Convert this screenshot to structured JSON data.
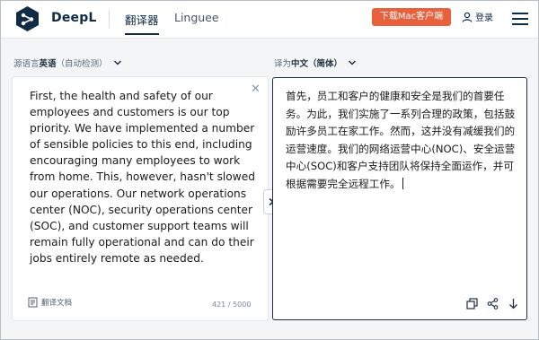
{
  "header": {
    "brand": "DeepL",
    "tabs": [
      {
        "label": "翻译器",
        "active": true
      },
      {
        "label": "Linguee",
        "active": false
      }
    ],
    "download_button": "下载Mac客户端",
    "login_label": "登录"
  },
  "source": {
    "lang_prefix": "源语言",
    "lang_name": "英语",
    "lang_suffix": "（自动检测）",
    "text": "First, the health and safety of our employees and customers is our top priority. We have implemented a number of sensible policies to this end, including encouraging many employees to work from home. This, however, hasn't slowed our operations. Our network operations center (NOC), security operations center (SOC), and customer support teams will remain fully operational and can do their jobs entirely remote as needed.",
    "translate_doc": "翻译文档",
    "char_count": "421 / 5000"
  },
  "target": {
    "lang_prefix": "译为",
    "lang_name": "中文（简体）",
    "text": "首先，员工和客户的健康和安全是我们的首要任务。为此，我们实施了一系列合理的政策，包括鼓励许多员工在家工作。然而，这并没有减缓我们的运营速度。我们的网络运营中心(NOC)、安全运营中心(SOC)和客户支持团队将保持全面运作，并可根据需要完全远程工作。"
  },
  "colors": {
    "brand_navy": "#0f2b46",
    "download_orange": "#e8603c",
    "background": "#f3f5f7"
  },
  "icons": [
    "deepl-logo-icon",
    "user-icon",
    "hamburger-menu-icon",
    "chevron-down-icon",
    "close-icon",
    "document-icon",
    "swap-arrow-icon",
    "copy-icon",
    "share-icon",
    "download-icon"
  ]
}
